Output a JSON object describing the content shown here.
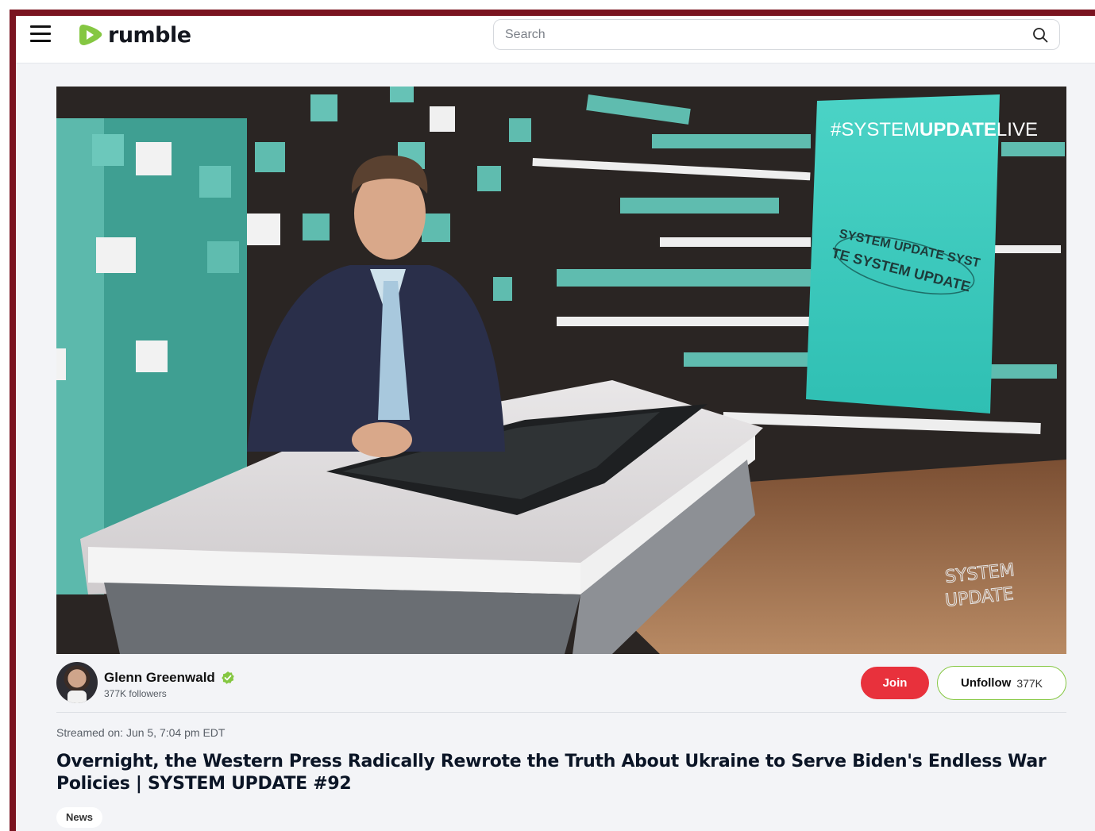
{
  "header": {
    "logo_text": "rumble",
    "search_placeholder": "Search"
  },
  "video": {
    "overlay_hashtag_prefix": "#SYSTEM",
    "overlay_hashtag_bold": "UPDATE",
    "overlay_hashtag_suffix": "LIVE",
    "ring_text_1": "SYSTEM UPDATE SYST",
    "ring_text_2": "TE SYSTEM UPDATE",
    "watermark_line1": "SYSTEM",
    "watermark_line2": "UPDATE"
  },
  "channel": {
    "name": "Glenn Greenwald",
    "followers": "377K followers",
    "join_label": "Join",
    "unfollow_label": "Unfollow",
    "unfollow_count": "377K"
  },
  "meta": {
    "streamed": "Streamed on: Jun 5, 7:04 pm EDT",
    "title": "Overnight, the Western Press Radically Rewrote the Truth About Ukraine to Serve Biden's Endless War Policies | SYSTEM UPDATE #92",
    "tag": "News"
  },
  "colors": {
    "brand_green": "#85c742",
    "join_red": "#e8313c",
    "frame_red": "#7a1420"
  }
}
